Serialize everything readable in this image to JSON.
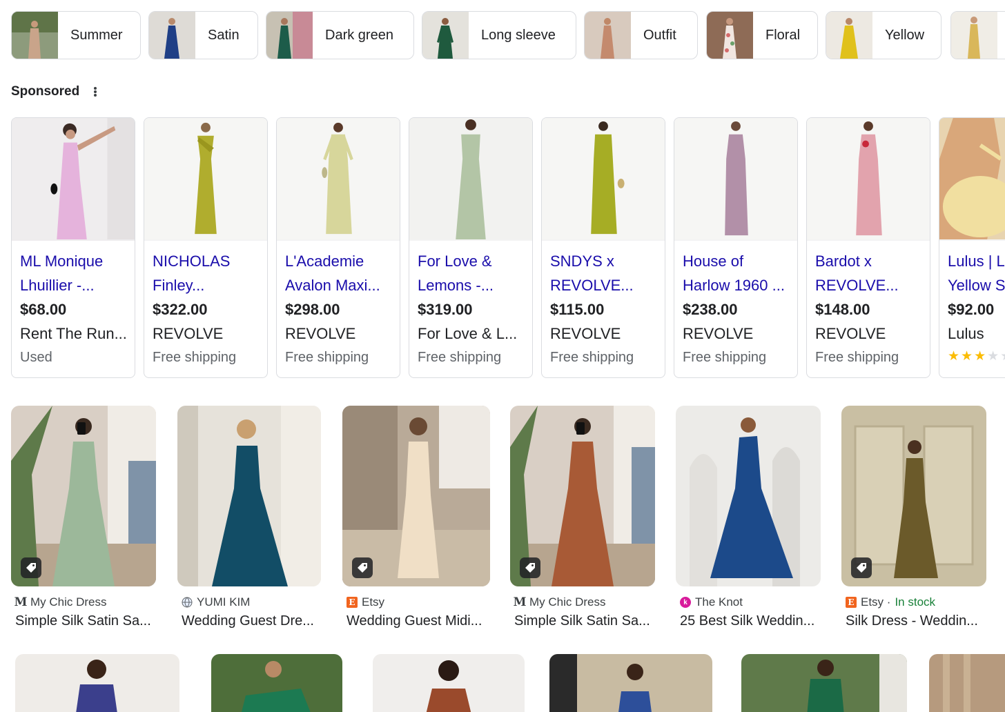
{
  "chips": [
    {
      "label": "Summer",
      "icon": "summer-thumbnail-icon",
      "color": "#c9a48a"
    },
    {
      "label": "Satin",
      "icon": "satin-thumbnail-icon",
      "color": "#1f3f86"
    },
    {
      "label": "Dark green",
      "icon": "dark-green-thumbnail-icon",
      "color": "#1d5c4a"
    },
    {
      "label": "Long sleeve",
      "icon": "long-sleeve-thumbnail-icon",
      "color": "#1f5a3e"
    },
    {
      "label": "Outfit",
      "icon": "outfit-thumbnail-icon",
      "color": "#c48a6e"
    },
    {
      "label": "Floral",
      "icon": "floral-thumbnail-icon",
      "color": "#d8b6a6"
    },
    {
      "label": "Yellow",
      "icon": "yellow-thumbnail-icon",
      "color": "#e0c11c"
    },
    {
      "label": "",
      "icon": "gold-thumbnail-icon",
      "color": "#d9b75a"
    }
  ],
  "sponsored": {
    "label": "Sponsored",
    "menu_icon": "kebab-menu-icon"
  },
  "products": [
    {
      "title_line1": "ML Monique",
      "title_line2": "Lhuillier -...",
      "price": "$68.00",
      "merchant": "Rent The Run...",
      "shipping": "Used",
      "dress_color": "#e5b3dc",
      "bg": "#f0eef0"
    },
    {
      "title_line1": "NICHOLAS",
      "title_line2": "Finley...",
      "price": "$322.00",
      "merchant": "REVOLVE",
      "shipping": "Free shipping",
      "dress_color": "#b0ad2e",
      "bg": "#f6f6f4"
    },
    {
      "title_line1": "L'Academie",
      "title_line2": "Avalon Maxi...",
      "price": "$298.00",
      "merchant": "REVOLVE",
      "shipping": "Free shipping",
      "dress_color": "#d7d69b",
      "bg": "#f6f6f4"
    },
    {
      "title_line1": "For Love &",
      "title_line2": "Lemons -...",
      "price": "$319.00",
      "merchant": "For Love & L...",
      "shipping": "Free shipping",
      "dress_color": "#b3c5a6",
      "bg": "#f2f2f0"
    },
    {
      "title_line1": "SNDYS x",
      "title_line2": "REVOLVE...",
      "price": "$115.00",
      "merchant": "REVOLVE",
      "shipping": "Free shipping",
      "dress_color": "#a6ad25",
      "bg": "#f6f6f4"
    },
    {
      "title_line1": "House of",
      "title_line2": "Harlow 1960 ...",
      "price": "$238.00",
      "merchant": "REVOLVE",
      "shipping": "Free shipping",
      "dress_color": "#b290a8",
      "bg": "#f6f6f4"
    },
    {
      "title_line1": "Bardot x",
      "title_line2": "REVOLVE...",
      "price": "$148.00",
      "merchant": "REVOLVE",
      "shipping": "Free shipping",
      "dress_color": "#e2a3ad",
      "bg": "#f6f6f4"
    },
    {
      "title_line1": "Lulus | L",
      "title_line2": "Yellow S",
      "price": "$92.00",
      "merchant": "Lulus",
      "shipping": "",
      "dress_color": "#f1dfa0",
      "bg": "#e8d4b0",
      "rating": 3
    }
  ],
  "results": [
    {
      "source": "My Chic Dress",
      "source_icon": "my-chic-dress-logo-icon",
      "title": "Simple Silk Satin Sa...",
      "stock": "",
      "tag": true,
      "dress_color": "#9cb89a",
      "bg": "#d9cfc5"
    },
    {
      "source": "YUMI KIM",
      "source_icon": "globe-icon",
      "title": "Wedding Guest Dre...",
      "stock": "",
      "tag": false,
      "dress_color": "#124d66",
      "bg": "#e6e2da"
    },
    {
      "source": "Etsy",
      "source_icon": "etsy-logo-icon",
      "title": "Wedding Guest Midi...",
      "stock": "",
      "tag": true,
      "dress_color": "#f0dfc6",
      "bg": "#b9aa98"
    },
    {
      "source": "My Chic Dress",
      "source_icon": "my-chic-dress-logo-icon",
      "title": "Simple Silk Satin Sa...",
      "stock": "",
      "tag": true,
      "dress_color": "#a85a36",
      "bg": "#d9cfc5"
    },
    {
      "source": "The Knot",
      "source_icon": "the-knot-logo-icon",
      "title": "25 Best Silk Weddin...",
      "stock": "",
      "tag": false,
      "dress_color": "#1c4a8a",
      "bg": "#ecebe8"
    },
    {
      "source": "Etsy · ",
      "source_icon": "etsy-logo-icon",
      "title": "Silk Dress - Weddin...",
      "stock": "In stock",
      "tag": true,
      "dress_color": "#6b5a2a",
      "bg": "#c9bfa3"
    }
  ],
  "bottom_tiles": [
    {
      "dress_color": "#3b3f8c",
      "bg": "#efece8"
    },
    {
      "dress_color": "#1c7a52",
      "bg": "#4e6e3a"
    },
    {
      "dress_color": "#9a4a2c",
      "bg": "#f0eeec"
    },
    {
      "dress_color": "#2d4f9a",
      "bg": "#c8bba2"
    },
    {
      "dress_color": "#1b6a46",
      "bg": "#5f7a4a"
    },
    {
      "dress_color": "#c9b193",
      "bg": "#b69a7e"
    }
  ],
  "colors": {
    "link": "#1a0dab",
    "text": "#202124",
    "muted": "#5f6368",
    "border": "#dadce0",
    "stock": "#188038",
    "star": "#fbbc04"
  }
}
